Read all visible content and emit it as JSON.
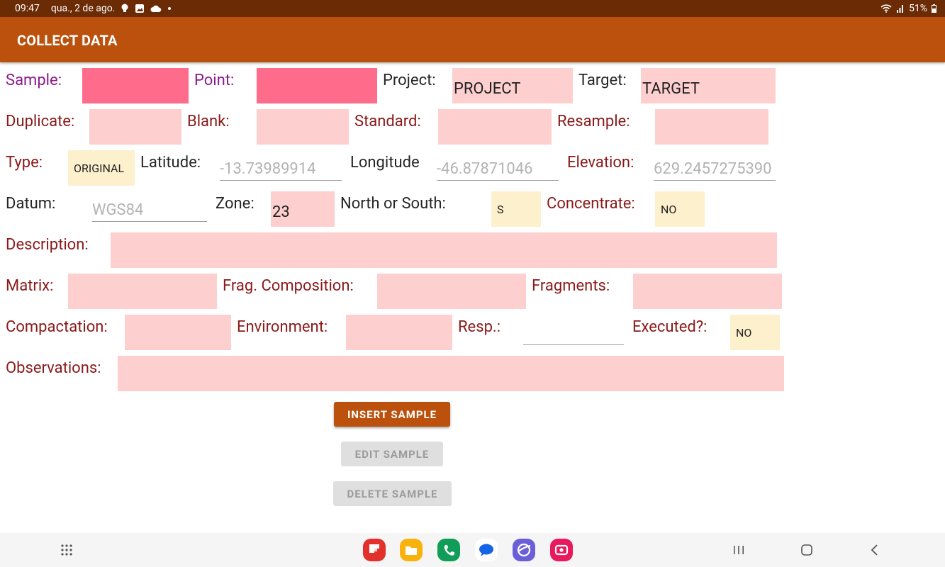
{
  "status_bar": {
    "time": "09:47",
    "date": "qua., 2 de ago.",
    "battery": "51%",
    "icons": [
      "bulb-icon",
      "image-icon",
      "cloud-icon",
      "dot-icon",
      "wifi-icon",
      "signal-icon",
      "battery-icon"
    ]
  },
  "app_bar": {
    "title": "COLLECT DATA"
  },
  "form": {
    "sample": {
      "label": "Sample:",
      "value": ""
    },
    "point": {
      "label": "Point:",
      "value": ""
    },
    "project": {
      "label": "Project:",
      "value": "PROJECT"
    },
    "target": {
      "label": "Target:",
      "value": "TARGET"
    },
    "duplicate": {
      "label": "Duplicate:",
      "value": ""
    },
    "blank": {
      "label": "Blank:",
      "value": ""
    },
    "standard": {
      "label": "Standard:",
      "value": ""
    },
    "resample": {
      "label": "Resample:",
      "value": ""
    },
    "type": {
      "label": "Type:",
      "value": "ORIGINAL"
    },
    "latitude": {
      "label": "Latitude:",
      "value": "-13.73989914"
    },
    "longitude": {
      "label": "Longitude",
      "value": "-46.87871046"
    },
    "elevation": {
      "label": "Elevation:",
      "value": "629.2457275390"
    },
    "datum": {
      "label": "Datum:",
      "value": "WGS84"
    },
    "zone": {
      "label": "Zone:",
      "value": "23"
    },
    "north_south": {
      "label": "North or South:",
      "value": "S"
    },
    "concentrate": {
      "label": "Concentrate:",
      "value": "NO"
    },
    "description": {
      "label": "Description:",
      "value": ""
    },
    "matrix": {
      "label": "Matrix:",
      "value": ""
    },
    "frag_composition": {
      "label": "Frag. Composition:",
      "value": ""
    },
    "fragments": {
      "label": "Fragments:",
      "value": ""
    },
    "compactation": {
      "label": "Compactation:",
      "value": ""
    },
    "environment": {
      "label": "Environment:",
      "value": ""
    },
    "resp": {
      "label": "Resp.:",
      "value": ""
    },
    "executed": {
      "label": "Executed?:",
      "value": "NO"
    },
    "observations": {
      "label": "Observations:",
      "value": ""
    }
  },
  "buttons": {
    "insert": "INSERT SAMPLE",
    "edit": "EDIT SAMPLE",
    "delete": "DELETE SAMPLE"
  },
  "nav_bar": {
    "apps": [
      {
        "name": "flipboard-app-icon",
        "color": "#e2312b"
      },
      {
        "name": "my-files-app-icon",
        "color": "#f9b20b"
      },
      {
        "name": "phone-app-icon",
        "color": "#0f9d58"
      },
      {
        "name": "messages-app-icon",
        "color": "#1464e6"
      },
      {
        "name": "internet-app-icon",
        "color": "#6b5fd8"
      },
      {
        "name": "screen-recorder-app-icon",
        "color": "#e8195c"
      }
    ]
  },
  "colors": {
    "status_bar": "#6b2b05",
    "app_bar": "#bb510c",
    "field_pink": "#fecfcf",
    "field_hot_pink": "#ff6b8a",
    "field_cream": "#fdf0cc",
    "label_red": "#8a1a1a",
    "label_purple": "#8a1a8a"
  }
}
